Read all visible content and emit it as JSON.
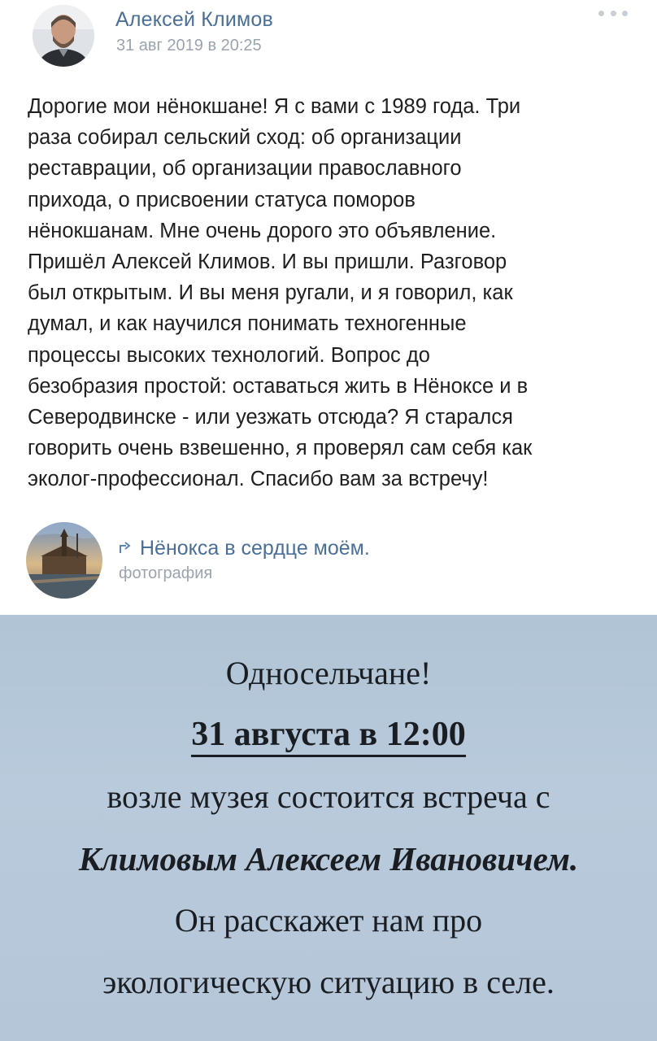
{
  "post": {
    "author": "Алексей Климов",
    "date": "31 авг 2019 в 20:25",
    "text": "Дорогие мои нёнокшане! Я с вами с 1989 года. Три\nраза собирал сельский сход: об организации\nреставрации, об организации православного\nприхода, о присвоении статуса поморов\nнёнокшанам. Мне очень дорого это объявление.\nПришёл Алексей Климов. И вы пришли. Разговор\nбыл открытым. И вы меня ругали, и я говорил, как\nдумал, и как научился понимать техногенные\nпроцессы высоких технологий. Вопрос до\nбезобразия простой: оставаться жить в Нёноксе и в\nСеверодвинске - или уезжать отсюда? Я старался\nговорить очень взвешенно, я проверял сам себя как\nэколог-профессионал. Спасибо вам за встречу!"
  },
  "attachment": {
    "title": "Нёнокса в сердце моём.",
    "subtitle": "фотография"
  },
  "photo": {
    "lines": [
      "Односельчане!",
      "31 августа в 12:00",
      "возле музея состоится встреча с",
      "Климовым Алексеем Ивановичем.",
      "Он расскажет нам про",
      "экологическую ситуацию в селе."
    ]
  },
  "icons": {
    "more": "more-dots-icon",
    "share": "share-arrow-icon"
  },
  "colors": {
    "link": "#4a6f99",
    "meta": "#9aa4ae",
    "photo_bg": "#b4c6d8"
  }
}
